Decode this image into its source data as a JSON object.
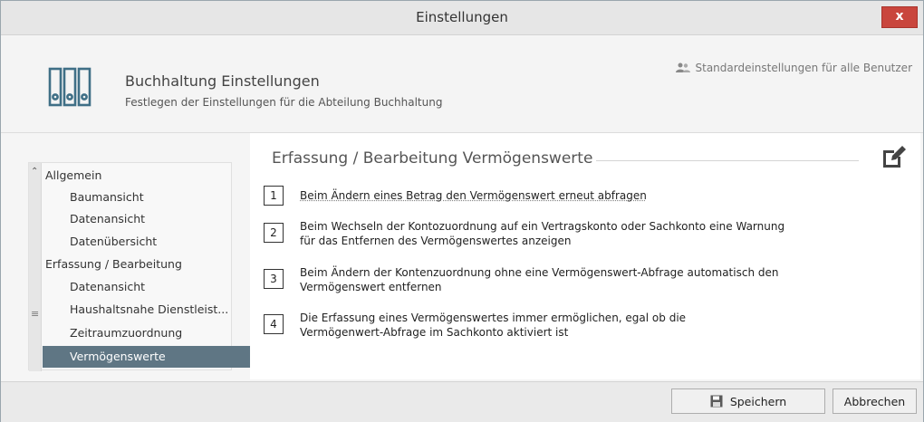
{
  "window": {
    "title": "Einstellungen",
    "close_label": "x"
  },
  "header": {
    "title": "Buchhaltung Einstellungen",
    "subtitle": "Festlegen der Einstellungen für die Abteilung Buchhaltung",
    "defaults_link": "Standardeinstellungen für alle Benutzer"
  },
  "sidebar": {
    "items": [
      {
        "label": "Allgemein",
        "level": 0,
        "active": false
      },
      {
        "label": "Baumansicht",
        "level": 1,
        "active": false
      },
      {
        "label": "Datenansicht",
        "level": 1,
        "active": false
      },
      {
        "label": "Datenübersicht",
        "level": 1,
        "active": false
      },
      {
        "label": "Erfassung / Bearbeitung",
        "level": 0,
        "active": false
      },
      {
        "label": "Datenansicht",
        "level": 1,
        "active": false
      },
      {
        "label": "Haushaltsnahe Dienstleist...",
        "level": 1,
        "active": false
      },
      {
        "label": "Zeitraumzuordnung",
        "level": 1,
        "active": false
      },
      {
        "label": "Vermögenswerte",
        "level": 1,
        "active": true
      }
    ]
  },
  "main": {
    "section_title": "Erfassung / Bearbeitung Vermögenswerte",
    "options": [
      {
        "number": "1",
        "text": "Beim Ändern eines Betrag den Vermögenswert erneut abfragen"
      },
      {
        "number": "2",
        "text": "Beim Wechseln der Kontozuordnung auf ein Vertragskonto oder Sachkonto eine Warnung für das Entfernen des Vermögenswertes anzeigen"
      },
      {
        "number": "3",
        "text": "Beim Ändern der Kontenzuordnung ohne eine Vermögenswert-Abfrage automatisch den Vermögenswert entfernen"
      },
      {
        "number": "4",
        "text": "Die Erfassung eines Vermögenswertes immer ermöglichen, egal ob die Vermögenwert-Abfrage im Sachkonto aktiviert ist"
      }
    ]
  },
  "footer": {
    "save_label": "Speichern",
    "cancel_label": "Abbrechen"
  },
  "colors": {
    "accent": "#5f7684",
    "close": "#c9463d"
  }
}
